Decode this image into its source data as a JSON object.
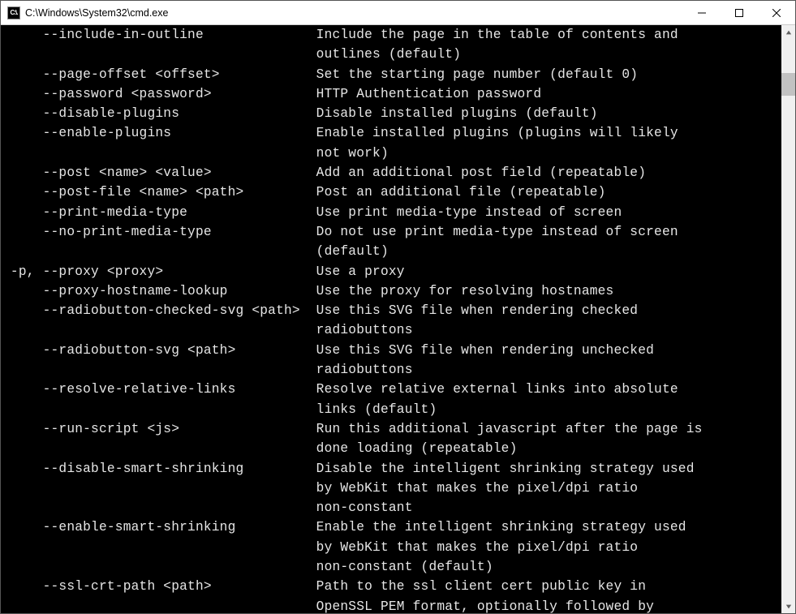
{
  "window": {
    "title": "C:\\Windows\\System32\\cmd.exe",
    "icon_label": "C:\\."
  },
  "options": [
    {
      "short": "",
      "long": "--include-in-outline",
      "desc": "Include the page in the table of contents and outlines (default)"
    },
    {
      "short": "",
      "long": "--page-offset <offset>",
      "desc": "Set the starting page number (default 0)"
    },
    {
      "short": "",
      "long": "--password <password>",
      "desc": "HTTP Authentication password"
    },
    {
      "short": "",
      "long": "--disable-plugins",
      "desc": "Disable installed plugins (default)"
    },
    {
      "short": "",
      "long": "--enable-plugins",
      "desc": "Enable installed plugins (plugins will likely not work)"
    },
    {
      "short": "",
      "long": "--post <name> <value>",
      "desc": "Add an additional post field (repeatable)"
    },
    {
      "short": "",
      "long": "--post-file <name> <path>",
      "desc": "Post an additional file (repeatable)"
    },
    {
      "short": "",
      "long": "--print-media-type",
      "desc": "Use print media-type instead of screen"
    },
    {
      "short": "",
      "long": "--no-print-media-type",
      "desc": "Do not use print media-type instead of screen (default)"
    },
    {
      "short": "-p,",
      "long": "--proxy <proxy>",
      "desc": "Use a proxy"
    },
    {
      "short": "",
      "long": "--proxy-hostname-lookup",
      "desc": "Use the proxy for resolving hostnames"
    },
    {
      "short": "",
      "long": "--radiobutton-checked-svg <path>",
      "desc": "Use this SVG file when rendering checked radiobuttons"
    },
    {
      "short": "",
      "long": "--radiobutton-svg <path>",
      "desc": "Use this SVG file when rendering unchecked radiobuttons"
    },
    {
      "short": "",
      "long": "--resolve-relative-links",
      "desc": "Resolve relative external links into absolute links (default)"
    },
    {
      "short": "",
      "long": "--run-script <js>",
      "desc": "Run this additional javascript after the page is done loading (repeatable)"
    },
    {
      "short": "",
      "long": "--disable-smart-shrinking",
      "desc": "Disable the intelligent shrinking strategy used by WebKit that makes the pixel/dpi ratio non-constant"
    },
    {
      "short": "",
      "long": "--enable-smart-shrinking",
      "desc": "Enable the intelligent shrinking strategy used by WebKit that makes the pixel/dpi ratio non-constant (default)"
    },
    {
      "short": "",
      "long": "--ssl-crt-path <path>",
      "desc": "Path to the ssl client cert public key in OpenSSL PEM format, optionally followed by"
    }
  ]
}
